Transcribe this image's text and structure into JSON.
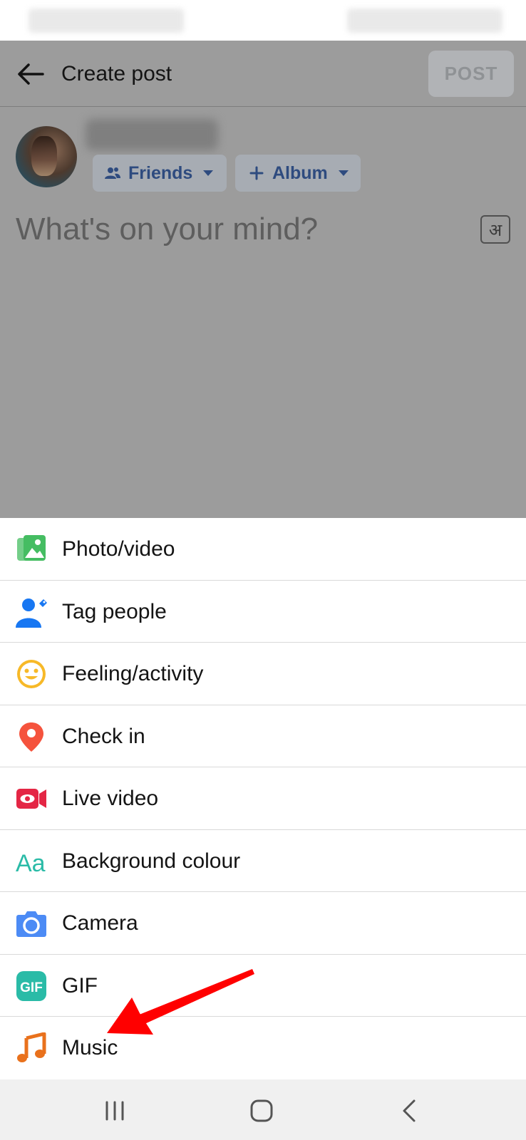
{
  "header": {
    "title": "Create post",
    "post_label": "POST"
  },
  "audience": {
    "friends_label": "Friends",
    "album_label": "Album"
  },
  "composer": {
    "placeholder": "What's on your mind?",
    "language_glyph": "अ"
  },
  "options": [
    {
      "label": "Photo/video",
      "icon": "photo-video-icon",
      "color": "#45bd62"
    },
    {
      "label": "Tag people",
      "icon": "tag-people-icon",
      "color": "#1877f2"
    },
    {
      "label": "Feeling/activity",
      "icon": "feeling-icon",
      "color": "#f7b928"
    },
    {
      "label": "Check in",
      "icon": "check-in-icon",
      "color": "#f5533d"
    },
    {
      "label": "Live video",
      "icon": "live-video-icon",
      "color": "#e42645"
    },
    {
      "label": "Background colour",
      "icon": "background-colour-icon",
      "color": "#2abba7"
    },
    {
      "label": "Camera",
      "icon": "camera-icon",
      "color": "#4c8bf5"
    },
    {
      "label": "GIF",
      "icon": "gif-icon",
      "color": "#2abba7"
    },
    {
      "label": "Music",
      "icon": "music-icon",
      "color": "#e9711c"
    }
  ],
  "nav": {
    "recents": "recents-icon",
    "home": "home-icon",
    "back": "back-nav-icon"
  },
  "annotation": {
    "arrow_color": "#ff0000"
  }
}
